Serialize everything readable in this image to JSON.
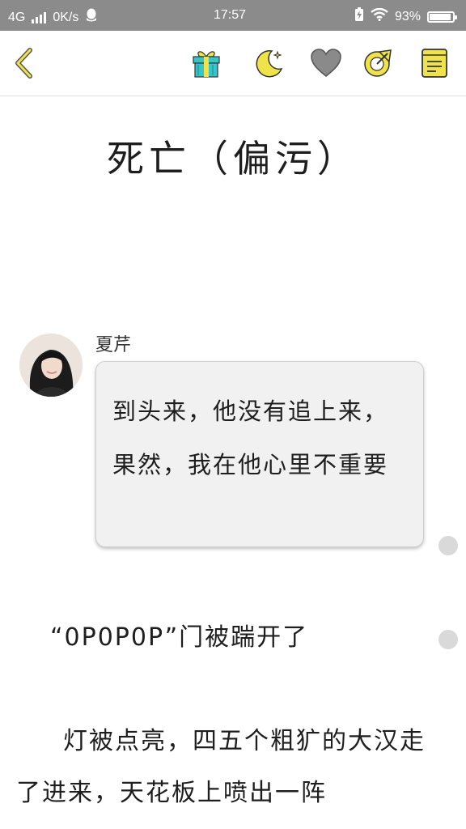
{
  "status_bar": {
    "network": "4G",
    "speed": "0K/s",
    "time": "17:57",
    "battery_percent": "93%",
    "battery_level": 0.93
  },
  "toolbar": {
    "back_icon": "chevron-left-icon",
    "gift_icon": "gift-icon",
    "night_mode_icon": "moon-icon",
    "favorite_icon": "heart-icon",
    "share_icon": "share-icon",
    "catalog_icon": "book-icon",
    "accent_color": "#f0e34a",
    "gift_color": "#35c6c9"
  },
  "chapter": {
    "title": "死亡（偏污）"
  },
  "dialogue": {
    "speaker": "夏芹",
    "text": "到头来，他没有追上来，果然，我在他心里不重要"
  },
  "paragraphs": [
    "“0P0P0P”门被踹开了",
    "灯被点亮，四五个粗犷的大汉走了进来，天花板上喷出一阵"
  ]
}
